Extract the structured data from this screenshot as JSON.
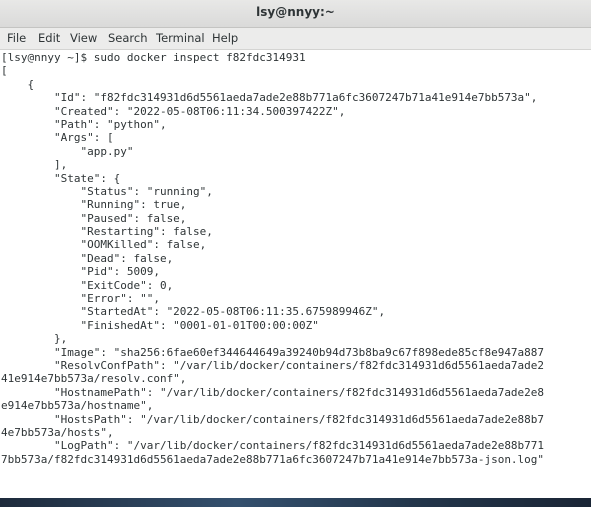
{
  "window": {
    "title": "lsy@nnyy:~"
  },
  "menubar": {
    "items": [
      "File",
      "Edit",
      "View",
      "Search",
      "Terminal",
      "Help"
    ]
  },
  "terminal": {
    "lines": [
      "[lsy@nnyy ~]$ sudo docker inspect f82fdc314931",
      "[",
      "    {",
      "        \"Id\": \"f82fdc314931d6d5561aeda7ade2e88b771a6fc3607247b71a41e914e7bb573a\",",
      "        \"Created\": \"2022-05-08T06:11:34.500397422Z\",",
      "        \"Path\": \"python\",",
      "        \"Args\": [",
      "            \"app.py\"",
      "        ],",
      "        \"State\": {",
      "            \"Status\": \"running\",",
      "            \"Running\": true,",
      "            \"Paused\": false,",
      "            \"Restarting\": false,",
      "            \"OOMKilled\": false,",
      "            \"Dead\": false,",
      "            \"Pid\": 5009,",
      "            \"ExitCode\": 0,",
      "            \"Error\": \"\",",
      "            \"StartedAt\": \"2022-05-08T06:11:35.675989946Z\",",
      "            \"FinishedAt\": \"0001-01-01T00:00:00Z\"",
      "        },",
      "        \"Image\": \"sha256:6fae60ef344644649a39240b94d73b8ba9c67f898ede85cf8e947a887",
      "        \"ResolvConfPath\": \"/var/lib/docker/containers/f82fdc314931d6d5561aeda7ade2",
      "41e914e7bb573a/resolv.conf\",",
      "        \"HostnamePath\": \"/var/lib/docker/containers/f82fdc314931d6d5561aeda7ade2e8",
      "e914e7bb573a/hostname\",",
      "        \"HostsPath\": \"/var/lib/docker/containers/f82fdc314931d6d5561aeda7ade2e88b7",
      "4e7bb573a/hosts\",",
      "        \"LogPath\": \"/var/lib/docker/containers/f82fdc314931d6d5561aeda7ade2e88b771",
      "7bb573a/f82fdc314931d6d5561aeda7ade2e88b771a6fc3607247b71a41e914e7bb573a-json.log\""
    ]
  }
}
